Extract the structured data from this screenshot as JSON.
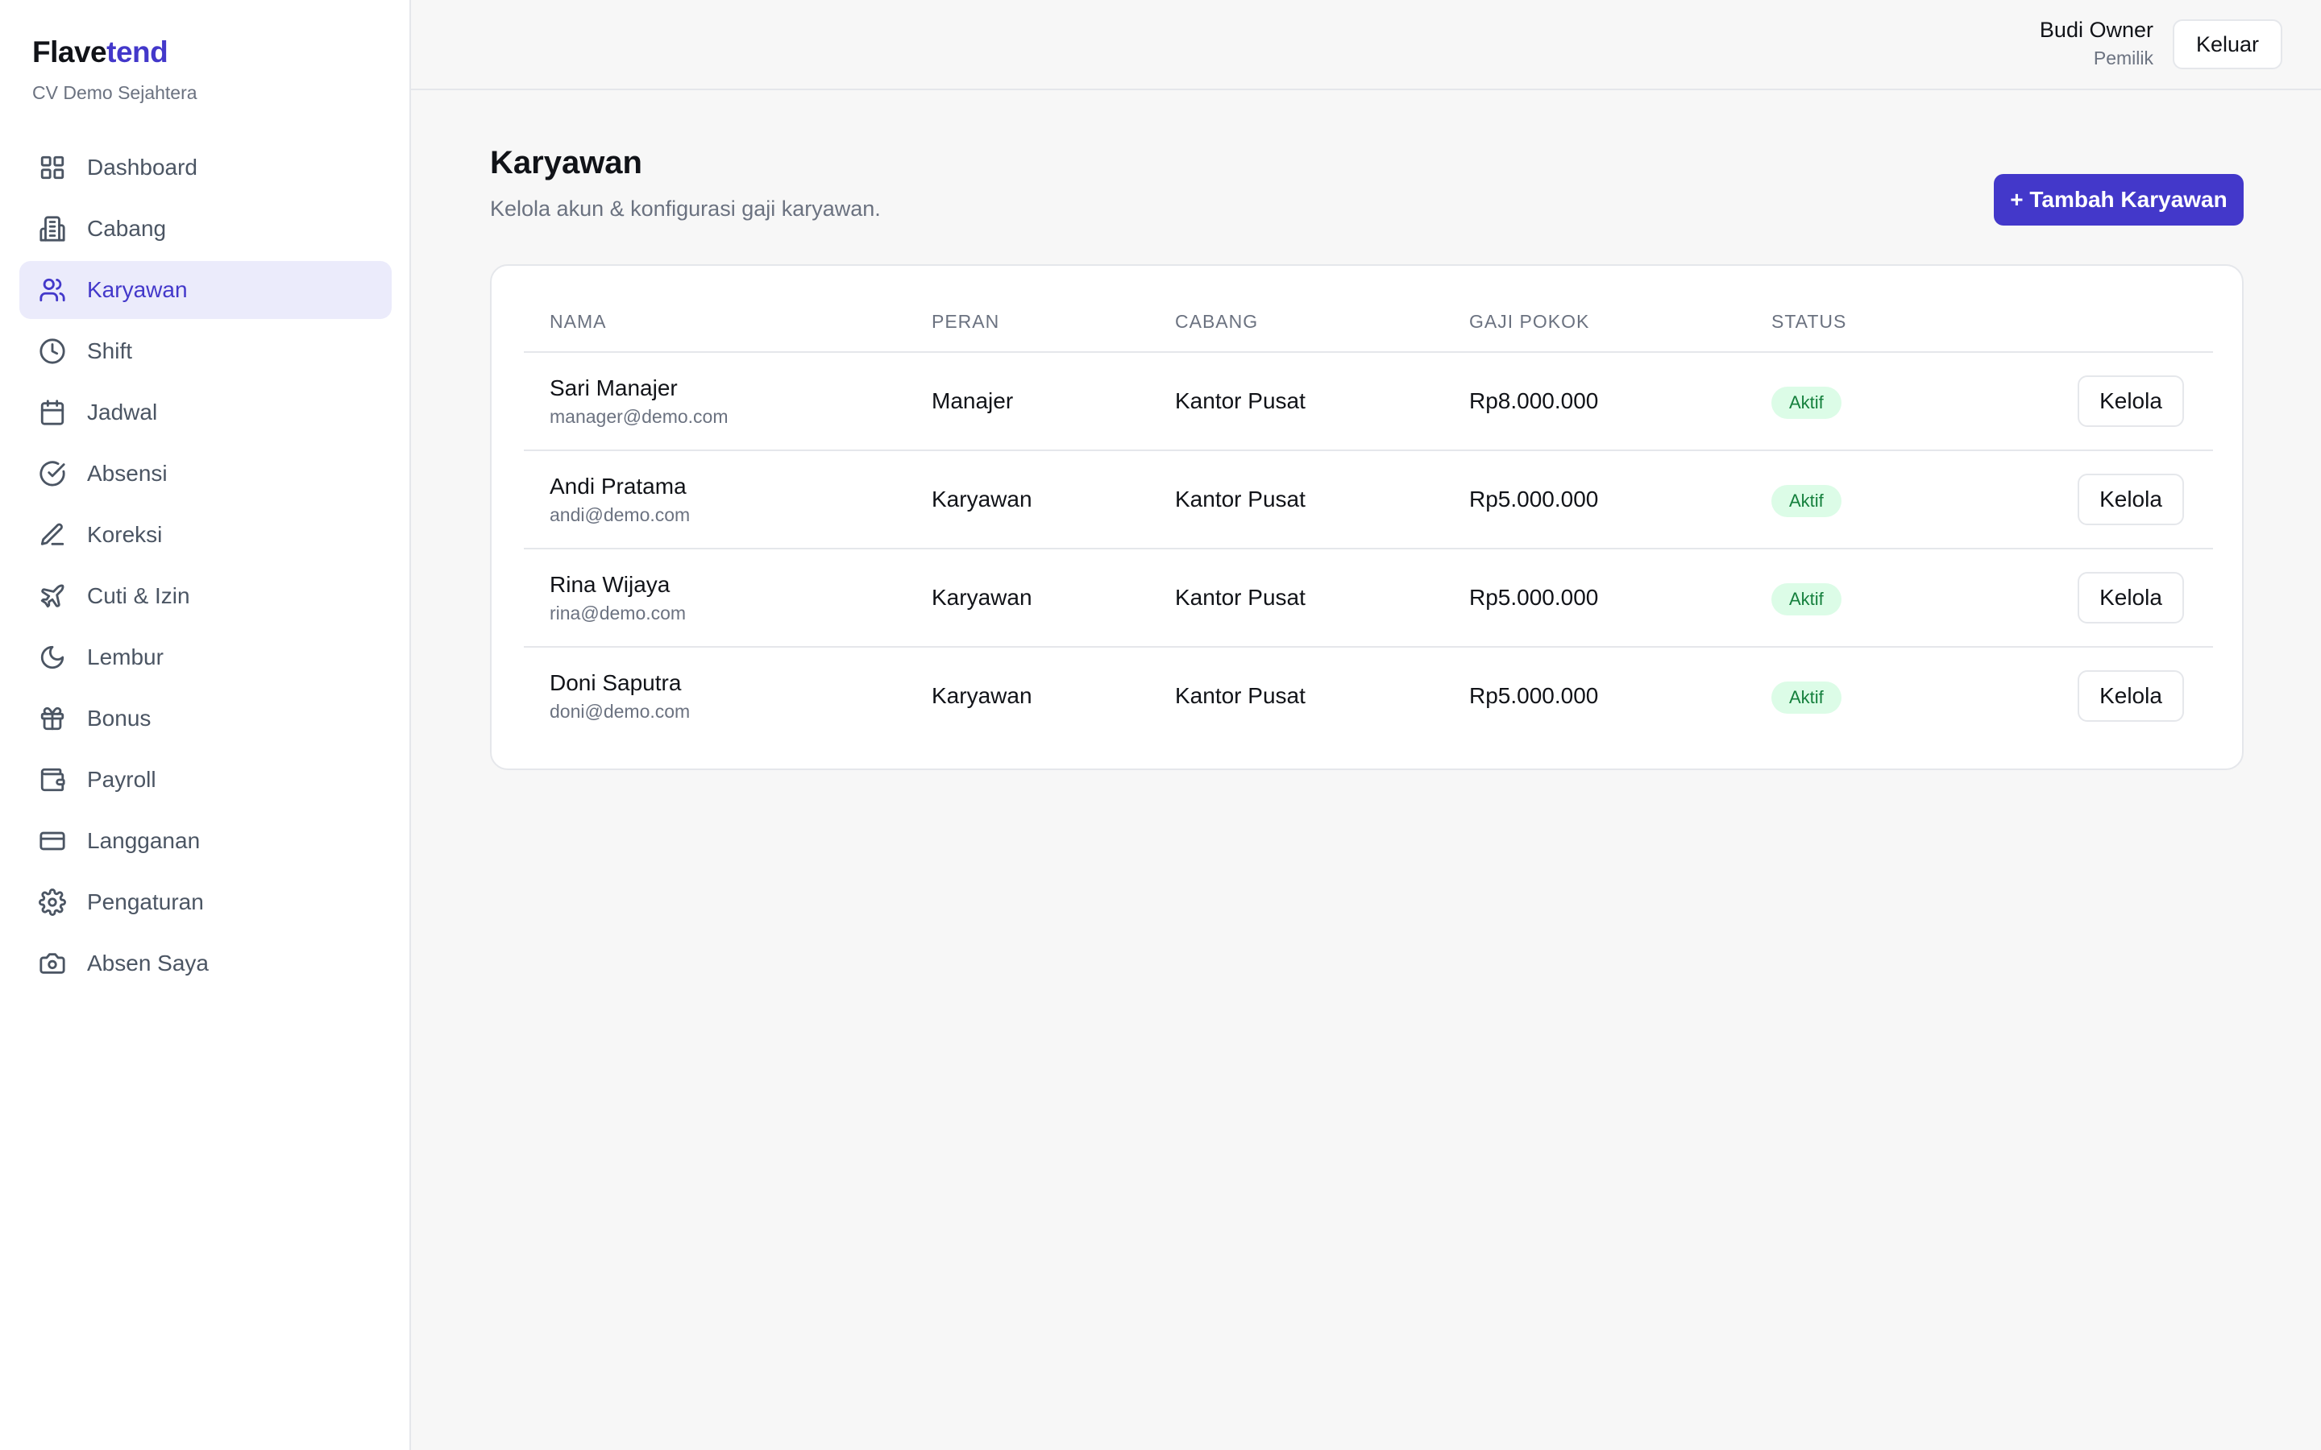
{
  "brand": {
    "part1": "Flave",
    "part2": "tend",
    "accent": "#4338ca"
  },
  "company": "CV Demo Sejahtera",
  "nav": [
    {
      "label": "Dashboard",
      "icon": "grid-icon"
    },
    {
      "label": "Cabang",
      "icon": "building-icon"
    },
    {
      "label": "Karyawan",
      "icon": "users-icon",
      "active": true
    },
    {
      "label": "Shift",
      "icon": "clock-icon"
    },
    {
      "label": "Jadwal",
      "icon": "calendar-icon"
    },
    {
      "label": "Absensi",
      "icon": "check-circle-icon"
    },
    {
      "label": "Koreksi",
      "icon": "pencil-icon"
    },
    {
      "label": "Cuti & Izin",
      "icon": "plane-icon"
    },
    {
      "label": "Lembur",
      "icon": "moon-icon"
    },
    {
      "label": "Bonus",
      "icon": "gift-icon"
    },
    {
      "label": "Payroll",
      "icon": "wallet-icon"
    },
    {
      "label": "Langganan",
      "icon": "credit-card-icon"
    },
    {
      "label": "Pengaturan",
      "icon": "gear-icon"
    },
    {
      "label": "Absen Saya",
      "icon": "camera-icon"
    }
  ],
  "user": {
    "name": "Budi Owner",
    "role": "Pemilik",
    "logout_label": "Keluar"
  },
  "page": {
    "title": "Karyawan",
    "subtitle": "Kelola akun & konfigurasi gaji karyawan.",
    "add_label": "+ Tambah Karyawan"
  },
  "table": {
    "headers": {
      "name": "NAMA",
      "role": "PERAN",
      "branch": "CABANG",
      "salary": "GAJI POKOK",
      "status": "STATUS"
    },
    "rows": [
      {
        "name": "Sari Manajer",
        "email": "manager@demo.com",
        "role": "Manajer",
        "branch": "Kantor Pusat",
        "salary": "Rp8.000.000",
        "status": "Aktif",
        "action": "Kelola"
      },
      {
        "name": "Andi Pratama",
        "email": "andi@demo.com",
        "role": "Karyawan",
        "branch": "Kantor Pusat",
        "salary": "Rp5.000.000",
        "status": "Aktif",
        "action": "Kelola"
      },
      {
        "name": "Rina Wijaya",
        "email": "rina@demo.com",
        "role": "Karyawan",
        "branch": "Kantor Pusat",
        "salary": "Rp5.000.000",
        "status": "Aktif",
        "action": "Kelola"
      },
      {
        "name": "Doni Saputra",
        "email": "doni@demo.com",
        "role": "Karyawan",
        "branch": "Kantor Pusat",
        "salary": "Rp5.000.000",
        "status": "Aktif",
        "action": "Kelola"
      }
    ]
  },
  "colors": {
    "status_bg": "#dcfce7",
    "status_text": "#15803d"
  }
}
